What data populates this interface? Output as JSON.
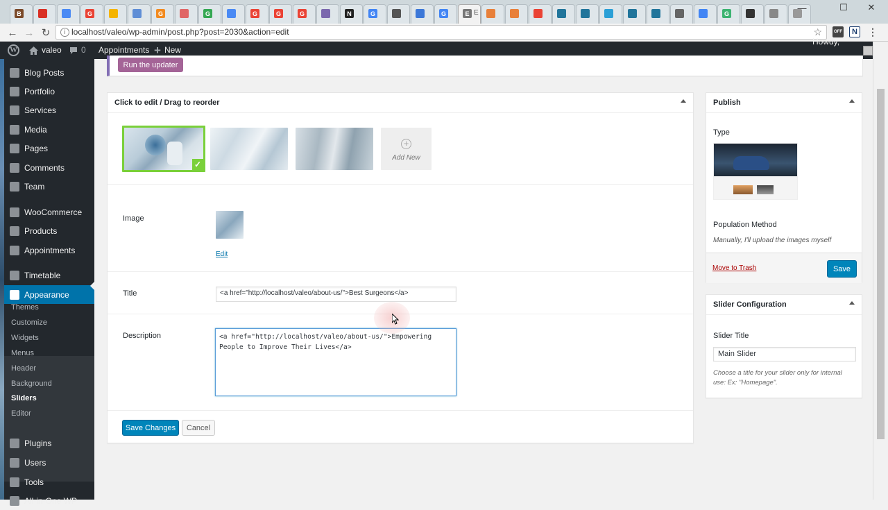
{
  "browser": {
    "tab_letters": [
      "B",
      "",
      "",
      "G",
      "",
      "",
      "G",
      "",
      "G",
      "",
      "G",
      "G",
      "G",
      "",
      "N",
      "G",
      "",
      "",
      "G",
      "E",
      "",
      "",
      "",
      "",
      "",
      "",
      "",
      "",
      "",
      "",
      "G",
      "",
      "",
      "",
      ""
    ],
    "active_tab_label": "E",
    "url": "localhost/valeo/wp-admin/post.php?post=2030&action=edit",
    "info_glyph": "i",
    "back_icon": "←",
    "forward_icon": "→",
    "reload_icon": "↻",
    "star_icon": "☆",
    "window_controls": [
      "—",
      "☐",
      "✕"
    ],
    "ext_labels": [
      "OFF",
      "N",
      "⋮"
    ]
  },
  "adminbar": {
    "site_name": "valeo",
    "comments_count": "0",
    "appointments": "Appointments",
    "new_label": "New",
    "howdy": "Howdy, valeo",
    "wp_logo": "W",
    "plus": "+"
  },
  "sidebar": {
    "items": [
      {
        "label": "Blog Posts",
        "icon": "pushpin-icon"
      },
      {
        "label": "Portfolio",
        "icon": "portfolio-icon"
      },
      {
        "label": "Services",
        "icon": "wrench-icon"
      },
      {
        "label": "Media",
        "icon": "media-icon"
      },
      {
        "label": "Pages",
        "icon": "pages-icon"
      },
      {
        "label": "Comments",
        "icon": "comments-icon"
      },
      {
        "label": "Team",
        "icon": "team-icon"
      },
      {
        "label": "WooCommerce",
        "icon": "woocommerce-icon"
      },
      {
        "label": "Products",
        "icon": "products-icon"
      },
      {
        "label": "Appointments",
        "icon": "appointments-icon"
      },
      {
        "label": "Timetable",
        "icon": "timetable-icon"
      },
      {
        "label": "Appearance",
        "icon": "appearance-icon"
      },
      {
        "label": "Plugins",
        "icon": "plugins-icon"
      },
      {
        "label": "Users",
        "icon": "users-icon"
      },
      {
        "label": "Tools",
        "icon": "tools-icon"
      },
      {
        "label": "All-in-One WP",
        "icon": "aio-icon"
      }
    ],
    "submenu": [
      "Themes",
      "Customize",
      "Widgets",
      "Menus",
      "Header",
      "Background",
      "Sliders",
      "Editor"
    ],
    "current_submenu": "Sliders"
  },
  "notice": {
    "button": "Run the updater"
  },
  "slides_panel": {
    "heading": "Click to edit / Drag to reorder",
    "add_new": "Add New",
    "check": "✓",
    "plus": "+"
  },
  "editor": {
    "image_label": "Image",
    "edit_link": "Edit",
    "title_label": "Title",
    "title_value": "<a href=\"http://localhost/valeo/about-us/\">Best Surgeons</a>",
    "description_label": "Description",
    "description_value": "<a href=\"http://localhost/valeo/about-us/\">Empowering\nPeople to Improve Their Lives</a>",
    "save_button": "Save Changes",
    "cancel_button": "Cancel"
  },
  "publish": {
    "heading": "Publish",
    "type_label": "Type",
    "population_label": "Population Method",
    "population_value": "Manually, I'll upload the images myself",
    "trash_link": "Move to Trash",
    "save_button": "Save"
  },
  "slider_config": {
    "heading": "Slider Configuration",
    "title_label": "Slider Title",
    "title_value": "Main Slider",
    "help": "Choose a title for your slider only for internal use: Ex: \"Homepage\"."
  }
}
